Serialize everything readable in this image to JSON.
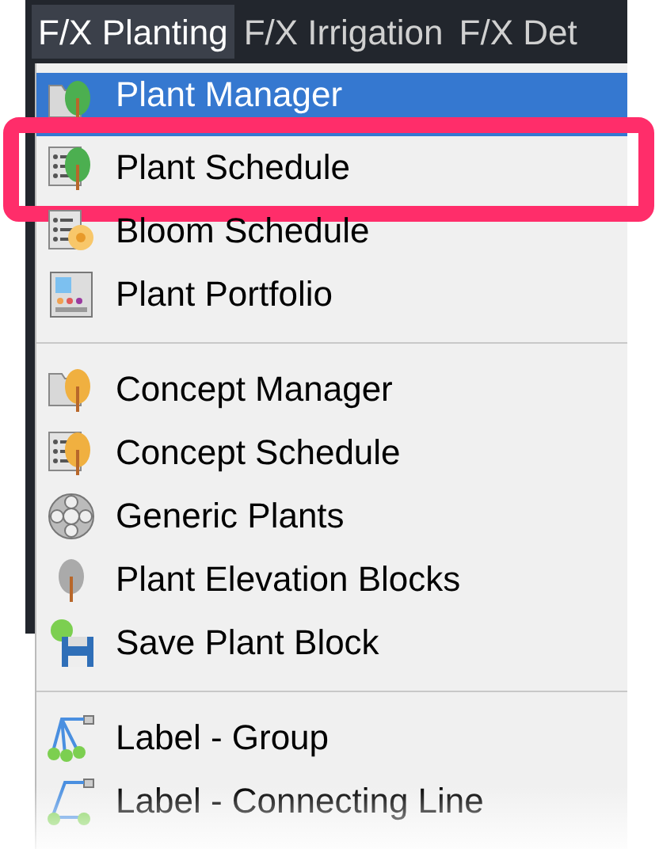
{
  "menubar": [
    {
      "label": "F/X Planting",
      "selected": true
    },
    {
      "label": "F/X Irrigation",
      "selected": false
    },
    {
      "label": "F/X Det",
      "selected": false
    }
  ],
  "menu": [
    {
      "kind": "item",
      "label": "Plant Manager",
      "selected": true,
      "highlighted": false
    },
    {
      "kind": "item",
      "label": "Plant Schedule",
      "selected": false,
      "highlighted": true
    },
    {
      "kind": "item",
      "label": "Bloom Schedule",
      "selected": false,
      "highlighted": false
    },
    {
      "kind": "item",
      "label": "Plant Portfolio",
      "selected": false,
      "highlighted": false
    },
    {
      "kind": "separator"
    },
    {
      "kind": "item",
      "label": "Concept Manager",
      "selected": false,
      "highlighted": false
    },
    {
      "kind": "item",
      "label": "Concept Schedule",
      "selected": false,
      "highlighted": false
    },
    {
      "kind": "item",
      "label": "Generic Plants",
      "selected": false,
      "highlighted": false
    },
    {
      "kind": "item",
      "label": "Plant Elevation Blocks",
      "selected": false,
      "highlighted": false
    },
    {
      "kind": "item",
      "label": "Save Plant Block",
      "selected": false,
      "highlighted": false
    },
    {
      "kind": "separator"
    },
    {
      "kind": "item",
      "label": "Label - Group",
      "selected": false,
      "highlighted": false
    },
    {
      "kind": "item",
      "label": "Label - Connecting Line",
      "selected": false,
      "highlighted": false
    }
  ]
}
